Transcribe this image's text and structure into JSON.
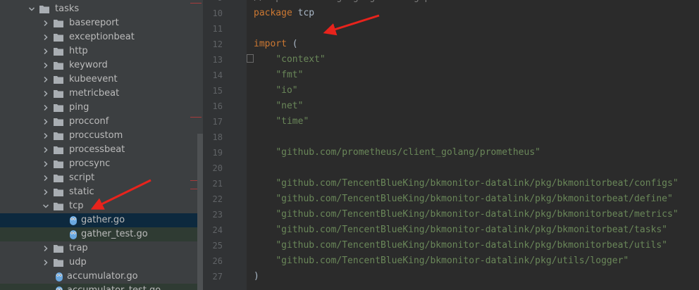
{
  "tree": {
    "items": [
      {
        "label": "tasks",
        "kind": "folder",
        "expanded": true,
        "depth": 0
      },
      {
        "label": "basereport",
        "kind": "folder",
        "expanded": false,
        "depth": 1
      },
      {
        "label": "exceptionbeat",
        "kind": "folder",
        "expanded": false,
        "depth": 1
      },
      {
        "label": "http",
        "kind": "folder",
        "expanded": false,
        "depth": 1
      },
      {
        "label": "keyword",
        "kind": "folder",
        "expanded": false,
        "depth": 1
      },
      {
        "label": "kubeevent",
        "kind": "folder",
        "expanded": false,
        "depth": 1
      },
      {
        "label": "metricbeat",
        "kind": "folder",
        "expanded": false,
        "depth": 1
      },
      {
        "label": "ping",
        "kind": "folder",
        "expanded": false,
        "depth": 1
      },
      {
        "label": "procconf",
        "kind": "folder",
        "expanded": false,
        "depth": 1
      },
      {
        "label": "proccustom",
        "kind": "folder",
        "expanded": false,
        "depth": 1
      },
      {
        "label": "processbeat",
        "kind": "folder",
        "expanded": false,
        "depth": 1
      },
      {
        "label": "procsync",
        "kind": "folder",
        "expanded": false,
        "depth": 1
      },
      {
        "label": "script",
        "kind": "folder",
        "expanded": false,
        "depth": 1
      },
      {
        "label": "static",
        "kind": "folder",
        "expanded": false,
        "depth": 1
      },
      {
        "label": "tcp",
        "kind": "folder",
        "expanded": true,
        "depth": 1
      },
      {
        "label": "gather.go",
        "kind": "go-file",
        "depth": 2,
        "selected": true
      },
      {
        "label": "gather_test.go",
        "kind": "go-file",
        "depth": 2
      },
      {
        "label": "trap",
        "kind": "folder",
        "expanded": false,
        "depth": 1
      },
      {
        "label": "udp",
        "kind": "folder",
        "expanded": false,
        "depth": 1
      },
      {
        "label": "accumulator.go",
        "kind": "go-file",
        "depth": 1
      },
      {
        "label": "accumulator_test.go",
        "kind": "go-file",
        "depth": 1
      }
    ]
  },
  "editor": {
    "lines": [
      {
        "num": "9",
        "tokens": [
          {
            "t": "// specific language governing permissions and limitations under the License.",
            "c": "cmt"
          }
        ]
      },
      {
        "num": "10",
        "tokens": [
          {
            "t": "package",
            "c": "kw"
          },
          {
            "t": " tcp",
            "c": "id"
          }
        ]
      },
      {
        "num": "11",
        "tokens": []
      },
      {
        "num": "12",
        "tokens": [
          {
            "t": "import",
            "c": "kw"
          },
          {
            "t": " (",
            "c": "id"
          }
        ]
      },
      {
        "num": "13",
        "tokens": [
          {
            "t": "    ",
            "c": "id"
          },
          {
            "t": "\"context\"",
            "c": "str"
          }
        ]
      },
      {
        "num": "14",
        "tokens": [
          {
            "t": "    ",
            "c": "id"
          },
          {
            "t": "\"fmt\"",
            "c": "str"
          }
        ]
      },
      {
        "num": "15",
        "tokens": [
          {
            "t": "    ",
            "c": "id"
          },
          {
            "t": "\"io\"",
            "c": "str"
          }
        ]
      },
      {
        "num": "16",
        "tokens": [
          {
            "t": "    ",
            "c": "id"
          },
          {
            "t": "\"net\"",
            "c": "str"
          }
        ]
      },
      {
        "num": "17",
        "tokens": [
          {
            "t": "    ",
            "c": "id"
          },
          {
            "t": "\"time\"",
            "c": "str"
          }
        ]
      },
      {
        "num": "18",
        "tokens": []
      },
      {
        "num": "19",
        "tokens": [
          {
            "t": "    ",
            "c": "id"
          },
          {
            "t": "\"github.com/prometheus/client_golang/prometheus\"",
            "c": "str"
          }
        ]
      },
      {
        "num": "20",
        "tokens": []
      },
      {
        "num": "21",
        "tokens": [
          {
            "t": "    ",
            "c": "id"
          },
          {
            "t": "\"github.com/TencentBlueKing/bkmonitor-datalink/pkg/bkmonitorbeat/configs\"",
            "c": "str"
          }
        ]
      },
      {
        "num": "22",
        "tokens": [
          {
            "t": "    ",
            "c": "id"
          },
          {
            "t": "\"github.com/TencentBlueKing/bkmonitor-datalink/pkg/bkmonitorbeat/define\"",
            "c": "str"
          }
        ]
      },
      {
        "num": "23",
        "tokens": [
          {
            "t": "    ",
            "c": "id"
          },
          {
            "t": "\"github.com/TencentBlueKing/bkmonitor-datalink/pkg/bkmonitorbeat/metrics\"",
            "c": "str"
          }
        ]
      },
      {
        "num": "24",
        "tokens": [
          {
            "t": "    ",
            "c": "id"
          },
          {
            "t": "\"github.com/TencentBlueKing/bkmonitor-datalink/pkg/bkmonitorbeat/tasks\"",
            "c": "str"
          }
        ]
      },
      {
        "num": "25",
        "tokens": [
          {
            "t": "    ",
            "c": "id"
          },
          {
            "t": "\"github.com/TencentBlueKing/bkmonitor-datalink/pkg/bkmonitorbeat/utils\"",
            "c": "str"
          }
        ]
      },
      {
        "num": "26",
        "tokens": [
          {
            "t": "    ",
            "c": "id"
          },
          {
            "t": "\"github.com/TencentBlueKing/bkmonitor-datalink/pkg/utils/logger\"",
            "c": "str"
          }
        ]
      },
      {
        "num": "27",
        "tokens": [
          {
            "t": ")",
            "c": "id"
          }
        ]
      }
    ]
  },
  "colors": {
    "tree_bg": "#3c3f41",
    "editor_bg": "#2b2b2b",
    "gutter_bg": "#313335",
    "keyword": "#cc7832",
    "string": "#6a8759",
    "identifier": "#a9b7c6",
    "selection": "#0d293e",
    "arrow": "#e8231c"
  },
  "icons": {
    "folder": "folder-icon",
    "go_file": "go-file-icon",
    "chevron_right": "chevron-right-icon",
    "chevron_down": "chevron-down-icon"
  }
}
